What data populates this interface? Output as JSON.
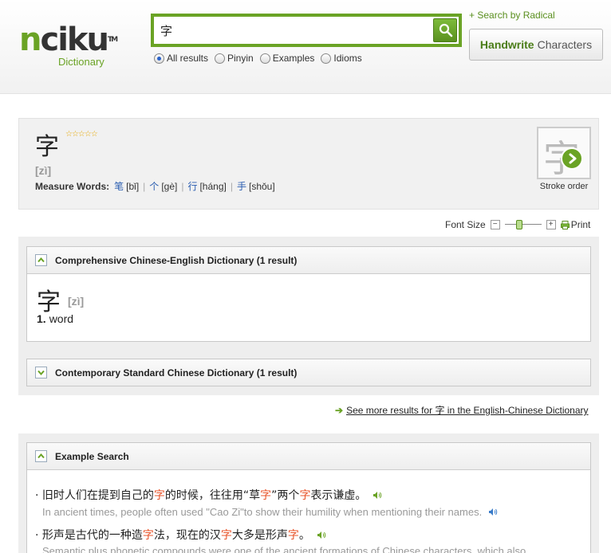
{
  "header": {
    "logo_n": "n",
    "logo_rest": "ciku",
    "logo_tm": "TM",
    "logo_sub": "Dictionary",
    "search_value": "字",
    "radios": [
      {
        "label": "All results",
        "checked": true
      },
      {
        "label": "Pinyin",
        "checked": false
      },
      {
        "label": "Examples",
        "checked": false
      },
      {
        "label": "Idioms",
        "checked": false
      }
    ],
    "radical_link": "+ Search by Radical",
    "handwrite_bold": "Handwrite",
    "handwrite_rest": "Characters"
  },
  "entry": {
    "char": "字",
    "stars": "☆☆☆☆☆",
    "pinyin": "[zì]",
    "measure_label": "Measure Words:",
    "measure_words": [
      {
        "char": "笔",
        "pinyin": "[bǐ]"
      },
      {
        "char": "个",
        "pinyin": "[gè]"
      },
      {
        "char": "行",
        "pinyin": "[háng]"
      },
      {
        "char": "手",
        "pinyin": "[shǒu]"
      }
    ],
    "stroke_char": "字",
    "stroke_label": "Stroke order"
  },
  "fontsize": {
    "label": "Font Size",
    "minus": "−",
    "plus": "+",
    "print": "Print"
  },
  "dict1": {
    "title": "Comprehensive Chinese-English Dictionary (1 result)",
    "char": "字",
    "pinyin": "[zì]",
    "def_num": "1.",
    "def_text": "word"
  },
  "dict2": {
    "title": "Contemporary Standard Chinese Dictionary (1 result)"
  },
  "more": {
    "text": "See more results for 字 in the English-Chinese Dictionary"
  },
  "examples": {
    "title": "Example Search",
    "items": [
      {
        "zh_parts": [
          "· 旧时人们在提到自己的",
          "字",
          "的时候，往往用“草",
          "字",
          "”两个",
          "字",
          "表示谦虚。"
        ],
        "en": "In ancient times, people often used \"Cao Zi\"to show their humility when mentioning their names."
      },
      {
        "zh_parts": [
          "· 形声是古代的一种造",
          "字",
          "法，现在的汉",
          "字",
          "大多是形声",
          "字",
          "。"
        ],
        "en": "Semantic plus phonetic compounds were one of the ancient formations of Chinese characters, which also"
      }
    ]
  },
  "colors": {
    "brand_green": "#6aa325",
    "highlight": "#e8552b",
    "link_blue": "#2a5db0"
  }
}
